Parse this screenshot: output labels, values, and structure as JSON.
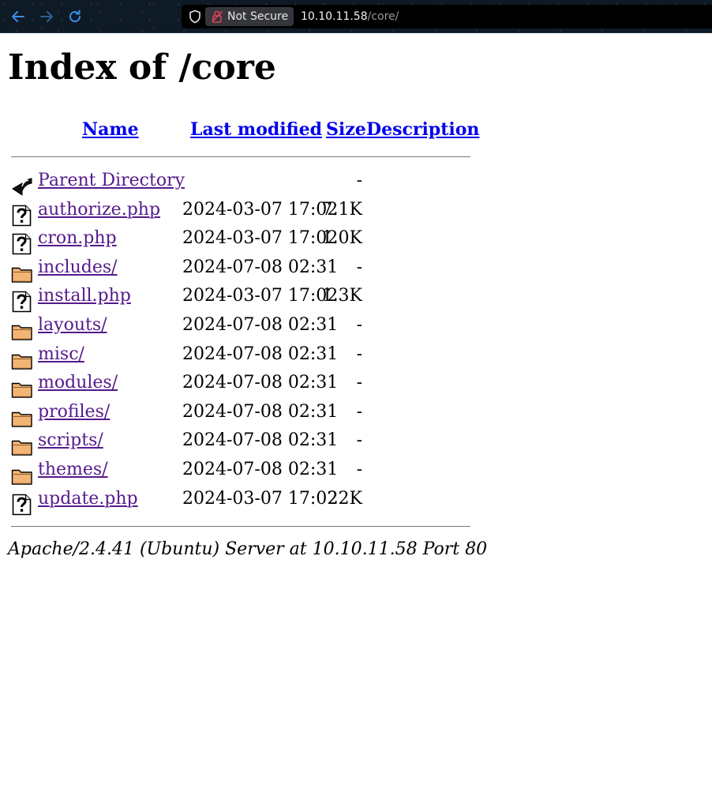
{
  "browser": {
    "security_label": "Not Secure",
    "url_host": "10.10.11.58",
    "url_path": "/core/"
  },
  "page": {
    "title": "Index of /core",
    "columns": {
      "name": "Name",
      "last_modified": "Last modified",
      "size": "Size",
      "description": "Description"
    },
    "entries": [
      {
        "icon": "back-icon",
        "name": "Parent Directory",
        "modified": "",
        "size": "-",
        "description": ""
      },
      {
        "icon": "unknown-file-icon",
        "name": "authorize.php",
        "modified": "2024-03-07 17:02",
        "size": "7.1K",
        "description": ""
      },
      {
        "icon": "unknown-file-icon",
        "name": "cron.php",
        "modified": "2024-03-07 17:02",
        "size": "1.0K",
        "description": ""
      },
      {
        "icon": "folder-icon",
        "name": "includes/",
        "modified": "2024-07-08 02:31",
        "size": "-",
        "description": ""
      },
      {
        "icon": "unknown-file-icon",
        "name": "install.php",
        "modified": "2024-03-07 17:02",
        "size": "1.3K",
        "description": ""
      },
      {
        "icon": "folder-icon",
        "name": "layouts/",
        "modified": "2024-07-08 02:31",
        "size": "-",
        "description": ""
      },
      {
        "icon": "folder-icon",
        "name": "misc/",
        "modified": "2024-07-08 02:31",
        "size": "-",
        "description": ""
      },
      {
        "icon": "folder-icon",
        "name": "modules/",
        "modified": "2024-07-08 02:31",
        "size": "-",
        "description": ""
      },
      {
        "icon": "folder-icon",
        "name": "profiles/",
        "modified": "2024-07-08 02:31",
        "size": "-",
        "description": ""
      },
      {
        "icon": "folder-icon",
        "name": "scripts/",
        "modified": "2024-07-08 02:31",
        "size": "-",
        "description": ""
      },
      {
        "icon": "folder-icon",
        "name": "themes/",
        "modified": "2024-07-08 02:31",
        "size": "-",
        "description": ""
      },
      {
        "icon": "unknown-file-icon",
        "name": "update.php",
        "modified": "2024-03-07 17:02",
        "size": "22K",
        "description": ""
      }
    ],
    "footer": "Apache/2.4.41 (Ubuntu) Server at 10.10.11.58 Port 80"
  },
  "colors": {
    "link_unvisited": "#0000ee",
    "link_visited": "#551a8b",
    "toolbar_bg": "#0e1a26",
    "nav_icon": "#3a8ee6",
    "insecure_lock": "#e0405a"
  }
}
